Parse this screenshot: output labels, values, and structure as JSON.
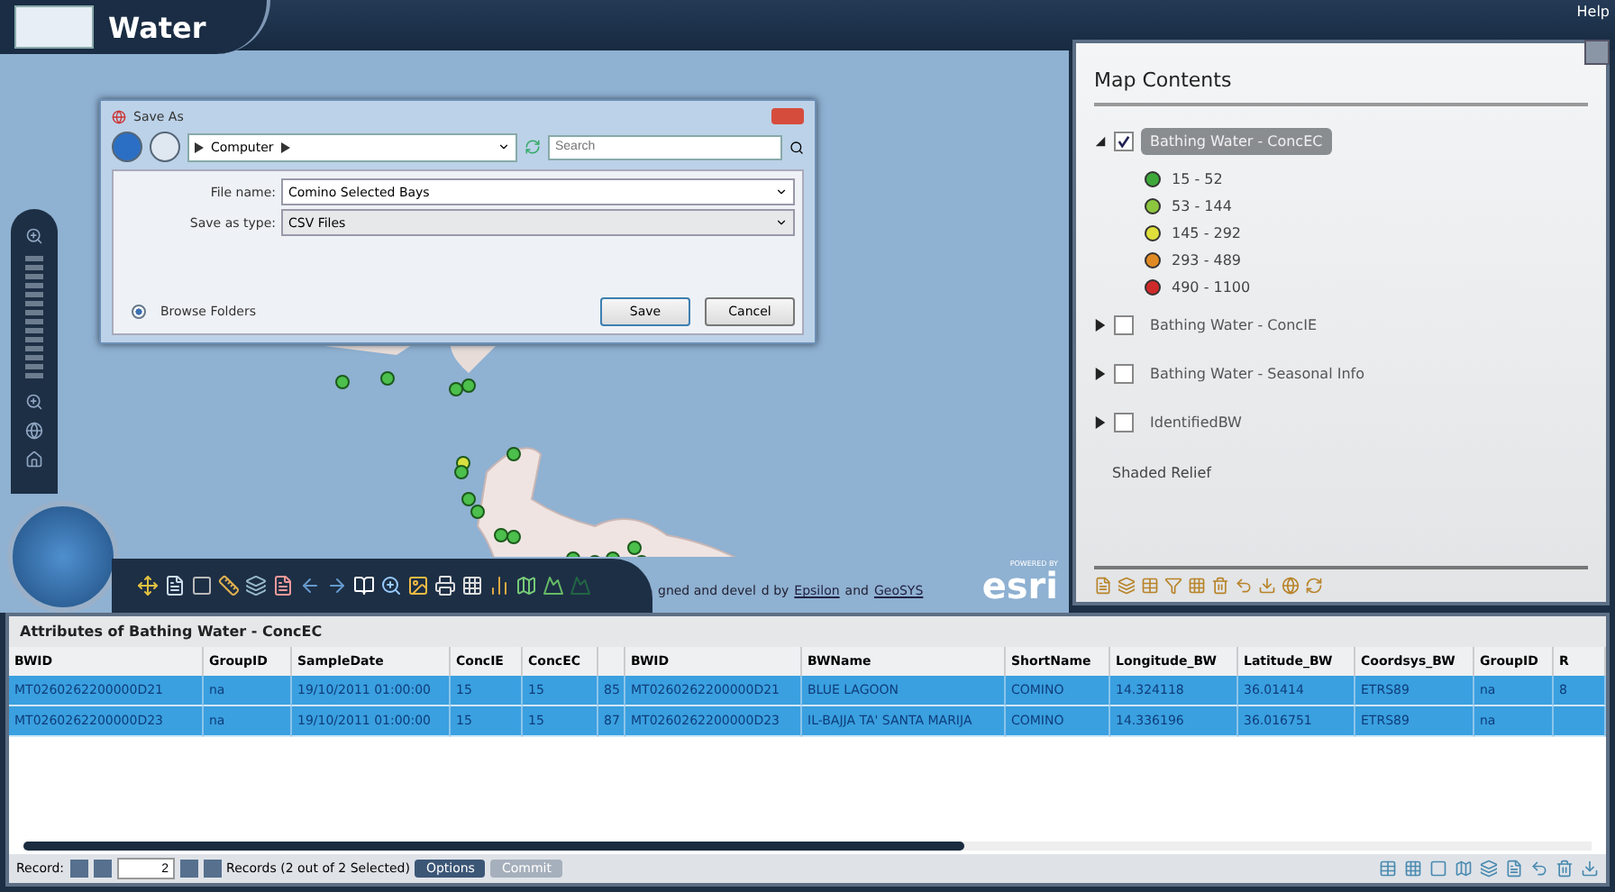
{
  "app": {
    "title": "Water",
    "help": "Help"
  },
  "save_dialog": {
    "title": "Save As",
    "breadcrumb": [
      "Computer"
    ],
    "search": {
      "placeholder": "Search"
    },
    "fields": [
      {
        "label": "File name:",
        "value": "Comino Selected Bays"
      },
      {
        "label": "Save as type:",
        "value": "CSV Files"
      }
    ],
    "browse": "Browse Folders",
    "buttons": [
      {
        "label": "Save",
        "kind": "primary"
      },
      {
        "label": "Cancel",
        "kind": "normal"
      }
    ]
  },
  "map": {
    "attribution": {
      "lead": "gned and devel",
      "mid": "d by",
      "links": [
        "Epsilon",
        "GeoSYS"
      ],
      "joiner": "and"
    },
    "logo": {
      "small": "POWERED BY",
      "text": "esri"
    }
  },
  "map_contents": {
    "title": "Map Contents",
    "layers": [
      {
        "label": "Bathing Water - ConcEC",
        "kind": "layer",
        "checked": true,
        "expanded": true,
        "selected": true,
        "legend": [
          {
            "label": "15 - 52",
            "color": "#3ea83a"
          },
          {
            "label": "53 - 144",
            "color": "#8cc63f"
          },
          {
            "label": "145 - 292",
            "color": "#dede3c"
          },
          {
            "label": "293 - 489",
            "color": "#e08a24"
          },
          {
            "label": "490 - 1100",
            "color": "#cf2a2a"
          }
        ]
      },
      {
        "label": "Bathing Water - ConcIE",
        "kind": "layer",
        "checked": false,
        "expanded": false,
        "selected": false
      },
      {
        "label": "Bathing Water - Seasonal Info",
        "kind": "layer",
        "checked": false,
        "expanded": false,
        "selected": false
      },
      {
        "label": "IdentifiedBW",
        "kind": "layer",
        "checked": false,
        "expanded": false,
        "selected": false
      },
      {
        "label": "Shaded Relief",
        "kind": "basemap"
      }
    ]
  },
  "attributes": {
    "title": "Attributes of Bathing Water - ConcEC",
    "columns": [
      "BWID",
      "GroupID",
      "SampleDate",
      "ConcIE",
      "ConcEC",
      "",
      "BWID",
      "BWName",
      "ShortName",
      "Longitude_BW",
      "Latitude_BW",
      "Coordsys_BW",
      "GroupID",
      "R"
    ],
    "rows": [
      {
        "selected": true,
        "cells": [
          "MT0260262200000D21",
          "na",
          "19/10/2011 01:00:00",
          "15",
          "15",
          "85",
          "MT0260262200000D21",
          "BLUE LAGOON",
          "COMINO",
          "14.324118",
          "36.01414",
          "ETRS89",
          "na",
          "8"
        ]
      },
      {
        "selected": true,
        "cells": [
          "MT0260262200000D23",
          "na",
          "19/10/2011 01:00:00",
          "15",
          "15",
          "87",
          "MT0260262200000D23",
          "IL-BAJJA TA' SANTA MARIJA",
          "COMINO",
          "14.336196",
          "36.016751",
          "ETRS89",
          "na",
          ""
        ]
      }
    ],
    "footer": {
      "record_label": "Record:",
      "record": "2",
      "summary": "Records (2 out of 2 Selected)",
      "buttons": [
        {
          "label": "Options",
          "disabled": false
        },
        {
          "label": "Commit",
          "disabled": true
        }
      ]
    }
  }
}
